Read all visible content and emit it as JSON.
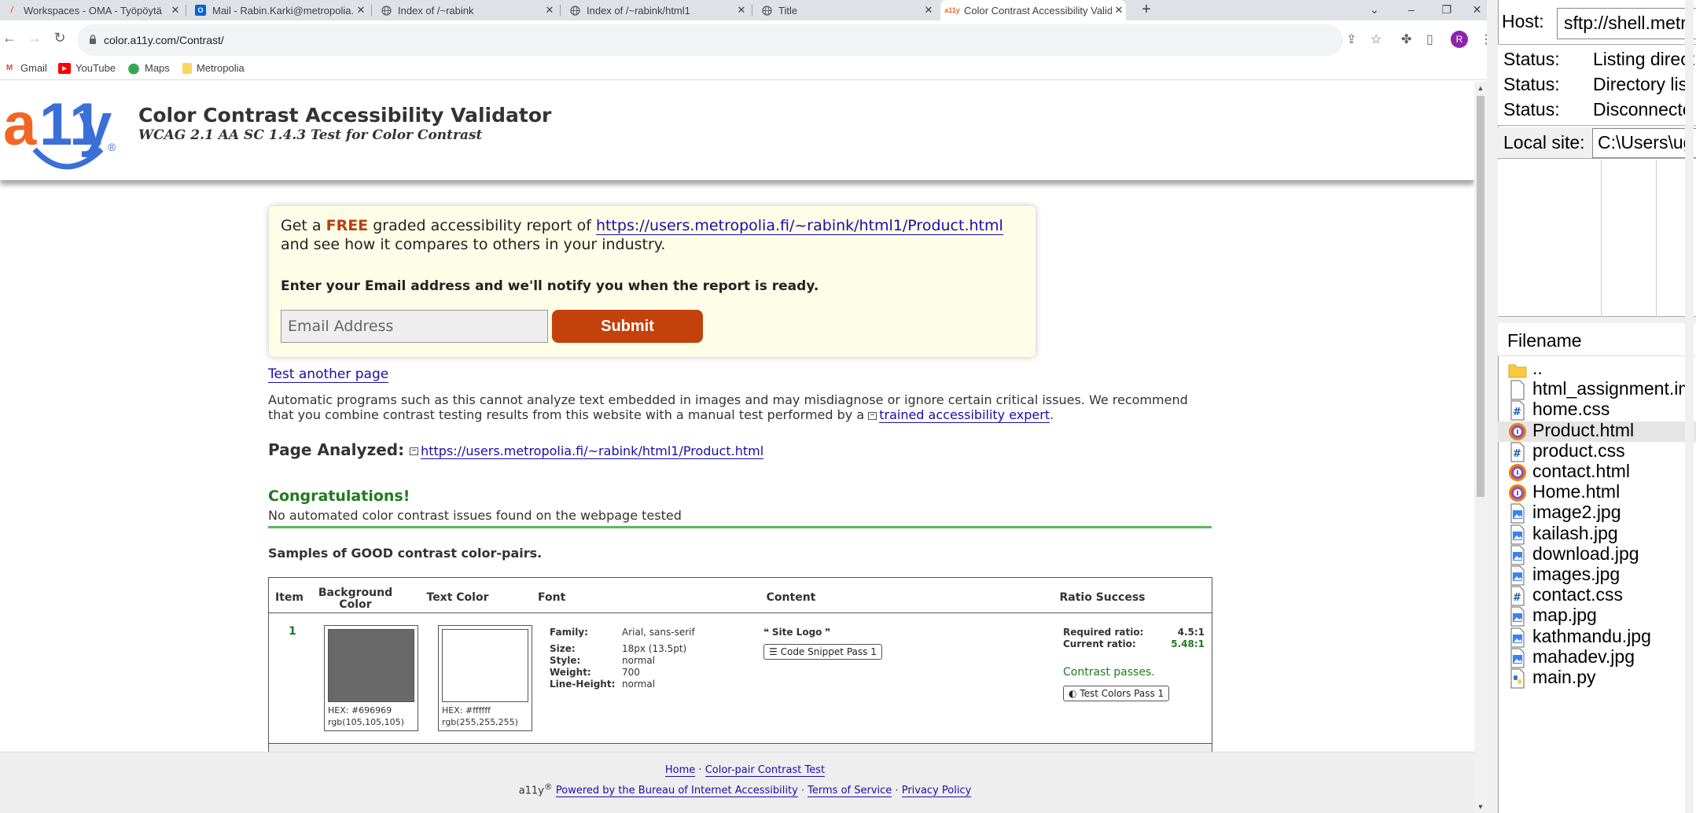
{
  "tabs": [
    {
      "label": "Workspaces - OMA - Työpöytä",
      "icon": "oma-icon"
    },
    {
      "label": "Mail - Rabin.Karki@metropolia.fi",
      "icon": "outlook-icon"
    },
    {
      "label": "Index of /~rabink",
      "icon": "globe-icon"
    },
    {
      "label": "Index of /~rabink/html1",
      "icon": "globe-icon"
    },
    {
      "label": "Title",
      "icon": "globe-icon"
    },
    {
      "label": "Color Contrast Accessibility Valid",
      "icon": "a11y-icon"
    }
  ],
  "address": {
    "url": "color.a11y.com/Contrast/"
  },
  "profile_initial": "R",
  "bookmarks": [
    {
      "label": "Gmail",
      "icon": "gmail-icon"
    },
    {
      "label": "YouTube",
      "icon": "youtube-icon"
    },
    {
      "label": "Maps",
      "icon": "maps-icon"
    },
    {
      "label": "Metropolia",
      "icon": "folder-icon"
    }
  ],
  "site": {
    "logo_text": "a11y",
    "title": "Color Contrast Accessibility Validator",
    "subtitle": "WCAG 2.1 AA SC 1.4.3 Test for Color Contrast"
  },
  "card": {
    "get_a": "Get a ",
    "free": "FREE",
    "graded": " graded accessibility report of ",
    "report_url": "https://users.metropolia.fi/~rabink/html1/Product.html",
    "compare": "and see how it compares to others in your industry.",
    "notify": "Enter your Email address and we'll notify you when the report is ready.",
    "email_placeholder": "Email Address",
    "submit": "Submit"
  },
  "main": {
    "test_another": "Test another page",
    "para_text": "Automatic programs such as this cannot analyze text embedded in images and may misdiagnose or ignore certain critical issues. We recommend that you combine contrast testing results from this website with a manual test performed by a ",
    "expert_link": "trained accessibility expert",
    "para_end": ".",
    "page_analyzed_label": "Page Analyzed:",
    "page_analyzed_url": "https://users.metropolia.fi/~rabink/html1/Product.html",
    "congrats": "Congratulations!",
    "no_issues": "No automated color contrast issues found on the webpage tested",
    "samples": "Samples of GOOD contrast color-pairs."
  },
  "table": {
    "headers": [
      "Item",
      "Background Color",
      "Text Color",
      "Font",
      "Content",
      "Ratio Success"
    ],
    "row": {
      "item": "1",
      "bg_hex": "HEX: #696969",
      "bg_rgb": "rgb(105,105,105)",
      "bg_color": "#696969",
      "text_hex": "HEX: #ffffff",
      "text_rgb": "rgb(255,255,255)",
      "text_color": "#ffffff",
      "font": {
        "family_k": "Family:",
        "family_v": "Arial, sans-serif",
        "size_k": "Size:",
        "size_v": "18px (13.5pt)",
        "style_k": "Style:",
        "style_v": "normal",
        "weight_k": "Weight:",
        "weight_v": "700",
        "lh_k": "Line-Height:",
        "lh_v": "normal"
      },
      "content": "Site Logo",
      "snippet_btn": "Code Snippet Pass 1",
      "required_k": "Required ratio:",
      "required_v": "4.5:1",
      "current_k": "Current ratio:",
      "current_v": "5.48:1",
      "contrast_passes": "Contrast passes.",
      "test_colors_btn": "Test Colors Pass 1"
    }
  },
  "footer": {
    "home": "Home",
    "sep1": " · ",
    "pair_test": "Color-pair Contrast Test",
    "brand": "a11y",
    "reg": "®",
    "powered": "Powered by the Bureau of Internet Accessibility",
    "terms": "Terms of Service",
    "privacy": "Privacy Policy"
  },
  "filezilla": {
    "host_label": "Host:",
    "host_value": "sftp://shell.metr",
    "status_lines": [
      {
        "label": "Status:",
        "text": "Listing direct"
      },
      {
        "label": "Status:",
        "text": "Directory list"
      },
      {
        "label": "Status:",
        "text": "Disconnecte"
      }
    ],
    "local_site_label": "Local site:",
    "local_site_value": "C:\\Users\\ug",
    "filename_header": "Filename",
    "files": [
      {
        "name": "..",
        "type": "folder"
      },
      {
        "name": "html_assignment.im",
        "type": "file"
      },
      {
        "name": "home.css",
        "type": "css"
      },
      {
        "name": "Product.html",
        "type": "html",
        "selected": true
      },
      {
        "name": "product.css",
        "type": "css"
      },
      {
        "name": "contact.html",
        "type": "html"
      },
      {
        "name": "Home.html",
        "type": "html"
      },
      {
        "name": "image2.jpg",
        "type": "image"
      },
      {
        "name": "kailash.jpg",
        "type": "image"
      },
      {
        "name": "download.jpg",
        "type": "image"
      },
      {
        "name": "images.jpg",
        "type": "image"
      },
      {
        "name": "contact.css",
        "type": "css"
      },
      {
        "name": "map.jpg",
        "type": "image"
      },
      {
        "name": "kathmandu.jpg",
        "type": "image"
      },
      {
        "name": "mahadev.jpg",
        "type": "image"
      },
      {
        "name": "main.py",
        "type": "python"
      }
    ]
  },
  "colors": {
    "accent_orange": "#c2410c",
    "logo_orange": "#f26522",
    "logo_blue": "#3a6fd8",
    "congrats_green": "#1f7a1f",
    "link_blue": "#1a0dab"
  }
}
